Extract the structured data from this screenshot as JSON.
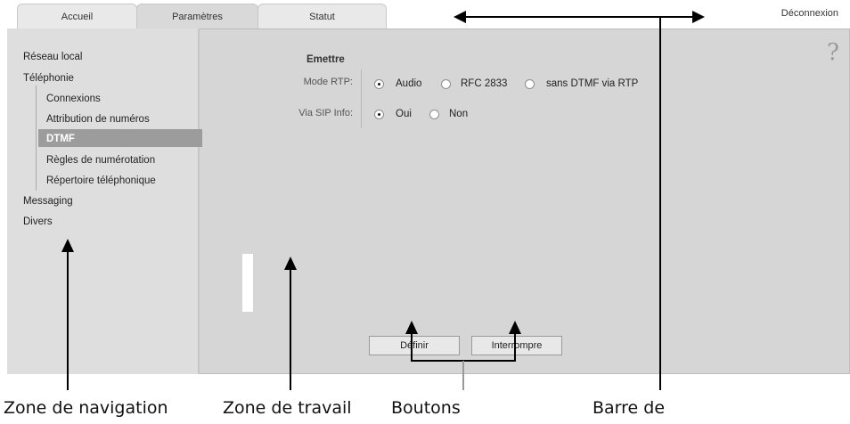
{
  "tabs": [
    {
      "label": "Accueil"
    },
    {
      "label": "Paramètres"
    },
    {
      "label": "Statut"
    }
  ],
  "logout_label": "Déconnexion",
  "help_label": "?",
  "nav": {
    "items": [
      {
        "label": "Réseau local"
      },
      {
        "label": "Téléphonie"
      },
      {
        "label": "Connexions"
      },
      {
        "label": "Attribution de numéros"
      },
      {
        "label": "DTMF"
      },
      {
        "label": "Règles de numérotation"
      },
      {
        "label": "Répertoire téléphonique"
      },
      {
        "label": "Messaging"
      },
      {
        "label": "Divers"
      }
    ]
  },
  "form": {
    "section_title": "Emettre",
    "rtp_label": "Mode RTP:",
    "rtp_options": [
      {
        "label": "Audio",
        "selected": true
      },
      {
        "label": "RFC 2833",
        "selected": false
      },
      {
        "label": "sans DTMF via RTP",
        "selected": false
      }
    ],
    "sip_label": "Via SIP Info:",
    "sip_options": [
      {
        "label": "Oui",
        "selected": true
      },
      {
        "label": "Non",
        "selected": false
      }
    ]
  },
  "buttons": {
    "define": "Définir",
    "cancel": "Interrompre"
  },
  "callouts": {
    "navigation": "Zone de navigation",
    "work": "Zone de travail",
    "buttons": "Boutons",
    "menubar": "Barre de"
  }
}
